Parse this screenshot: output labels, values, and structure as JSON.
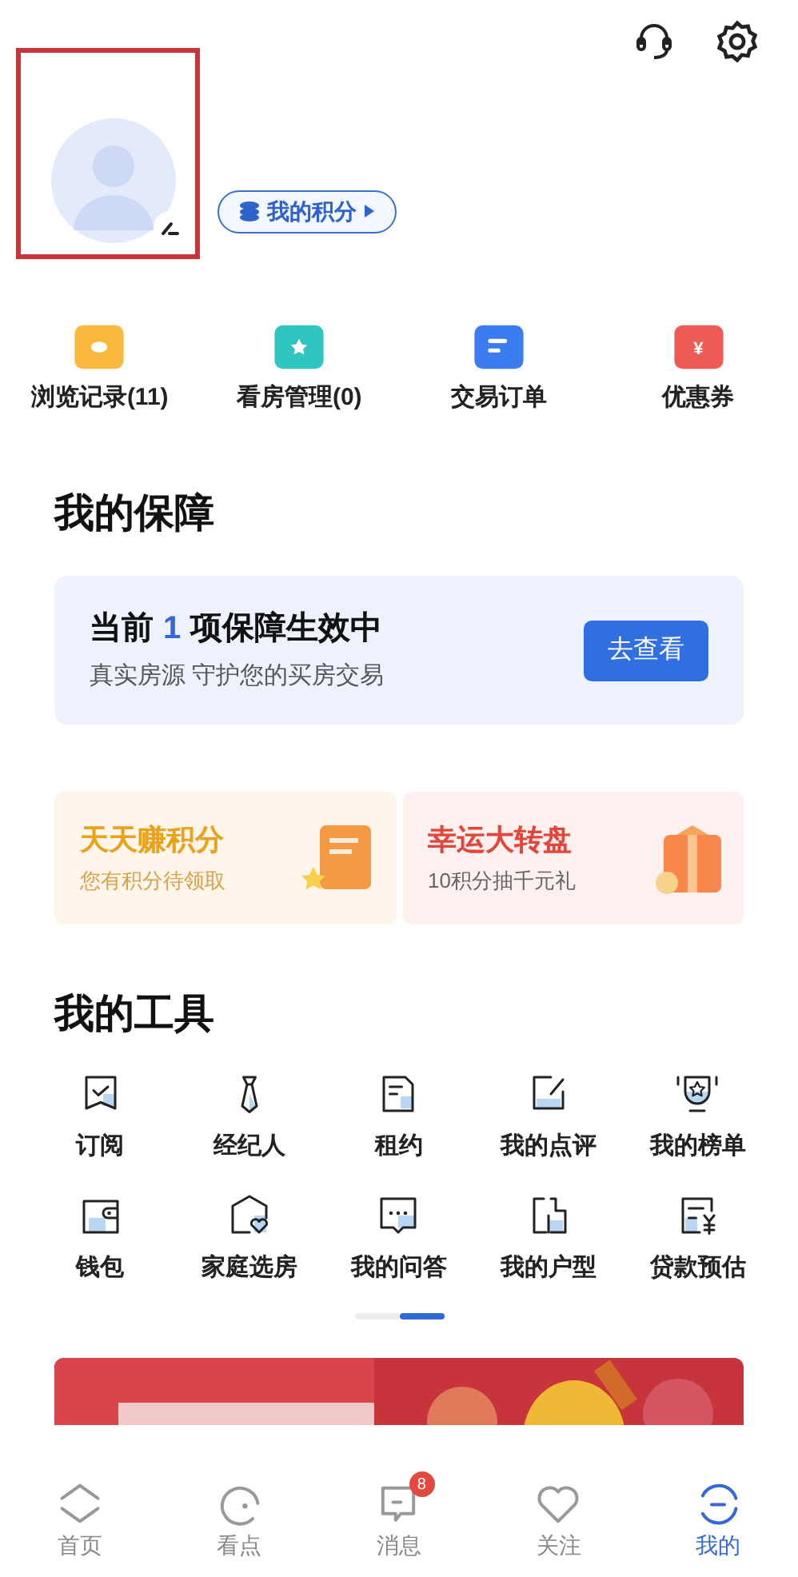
{
  "profile": {
    "points_button": "我的积分",
    "highlighted": true
  },
  "quick_links": [
    {
      "label": "浏览记录(11)",
      "kind": "history"
    },
    {
      "label": "看房管理(0)",
      "kind": "folder"
    },
    {
      "label": "交易订单",
      "kind": "order"
    },
    {
      "label": "优惠券",
      "kind": "coupon",
      "icon_text": "¥"
    }
  ],
  "protection": {
    "title": "我的保障",
    "headline_before": "当前",
    "count": "1",
    "headline_after": "项保障生效中",
    "subtitle": "真实房源 守护您的买房交易",
    "button": "去查看"
  },
  "promos": [
    {
      "title": "天天赚积分",
      "subtitle": "您有积分待领取",
      "kind": "points"
    },
    {
      "title": "幸运大转盘",
      "subtitle": "10积分抽千元礼",
      "kind": "wheel"
    }
  ],
  "tools": {
    "title": "我的工具",
    "items": [
      {
        "label": "订阅",
        "kind": "subscribe"
      },
      {
        "label": "经纪人",
        "kind": "agent"
      },
      {
        "label": "租约",
        "kind": "lease"
      },
      {
        "label": "我的点评",
        "kind": "review"
      },
      {
        "label": "我的榜单",
        "kind": "ranking"
      },
      {
        "label": "钱包",
        "kind": "wallet"
      },
      {
        "label": "家庭选房",
        "kind": "family"
      },
      {
        "label": "我的问答",
        "kind": "qa"
      },
      {
        "label": "我的户型",
        "kind": "floorplan"
      },
      {
        "label": "贷款预估",
        "kind": "loan"
      }
    ],
    "pager": [
      {
        "selected": false
      },
      {
        "selected": true
      }
    ]
  },
  "nav": [
    {
      "label": "首页",
      "kind": "home",
      "selected": false
    },
    {
      "label": "看点",
      "kind": "discover",
      "selected": false
    },
    {
      "label": "消息",
      "kind": "message",
      "selected": false,
      "badge": "8"
    },
    {
      "label": "关注",
      "kind": "follow",
      "selected": false
    },
    {
      "label": "我的",
      "kind": "me",
      "selected": true
    }
  ]
}
